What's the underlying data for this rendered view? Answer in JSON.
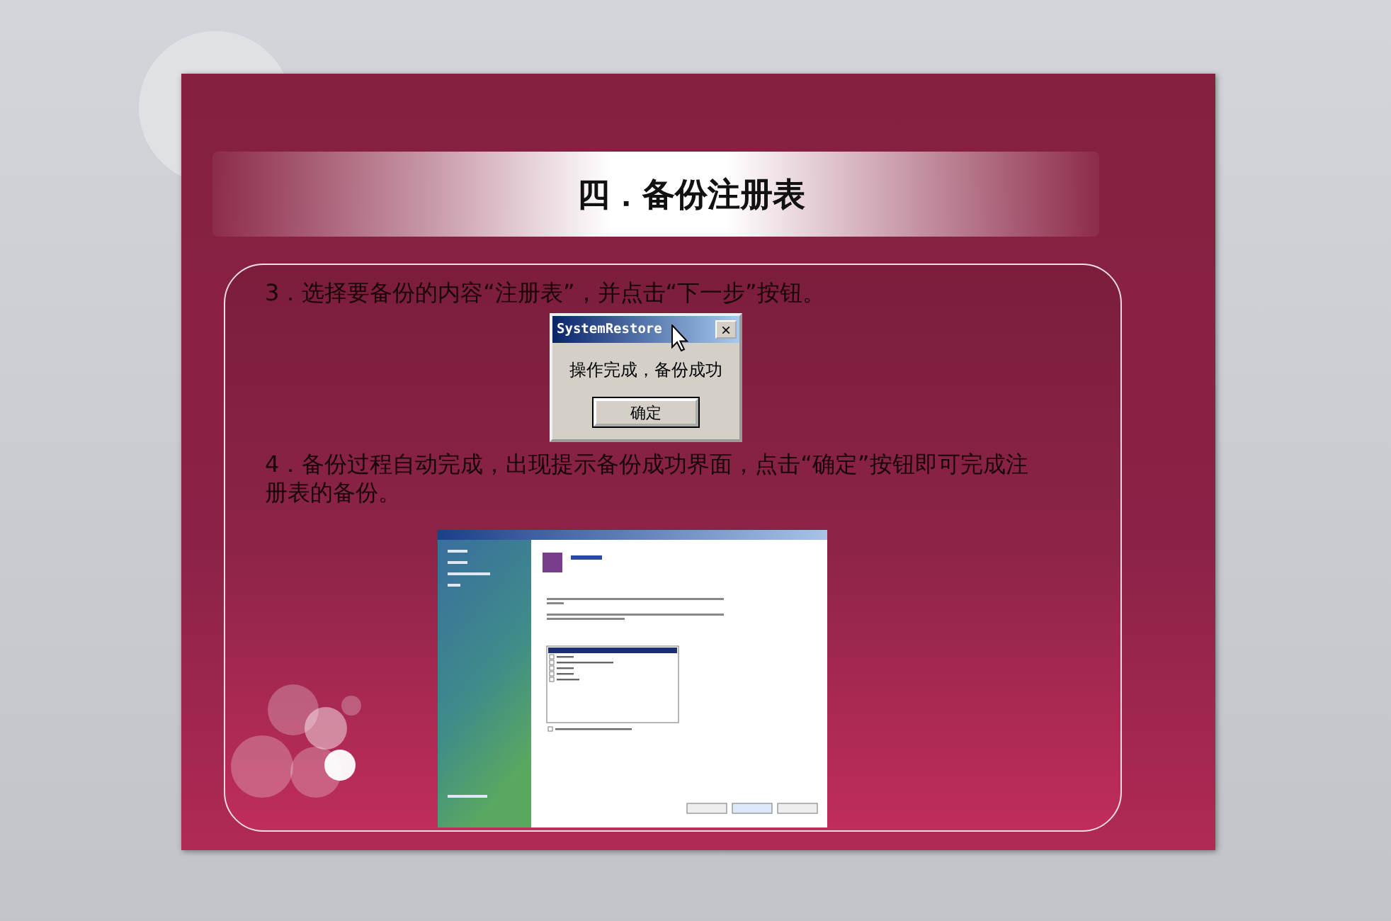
{
  "slide": {
    "title": "四．备份注册表",
    "content": [
      {
        "kind": "text",
        "text": "3．选择要备份的内容“注册表”，并点击“下一步”按钮。"
      },
      {
        "kind": "dialog",
        "title": "SystemRestore",
        "close": "×",
        "message": "操作完成，备份成功",
        "button": "确定"
      },
      {
        "kind": "text",
        "text": "4．备份过程自动完成，出现提示备份成功界面，点击“确定”按钮即可完成注册表的备份。"
      },
      {
        "kind": "screenshot"
      }
    ]
  }
}
